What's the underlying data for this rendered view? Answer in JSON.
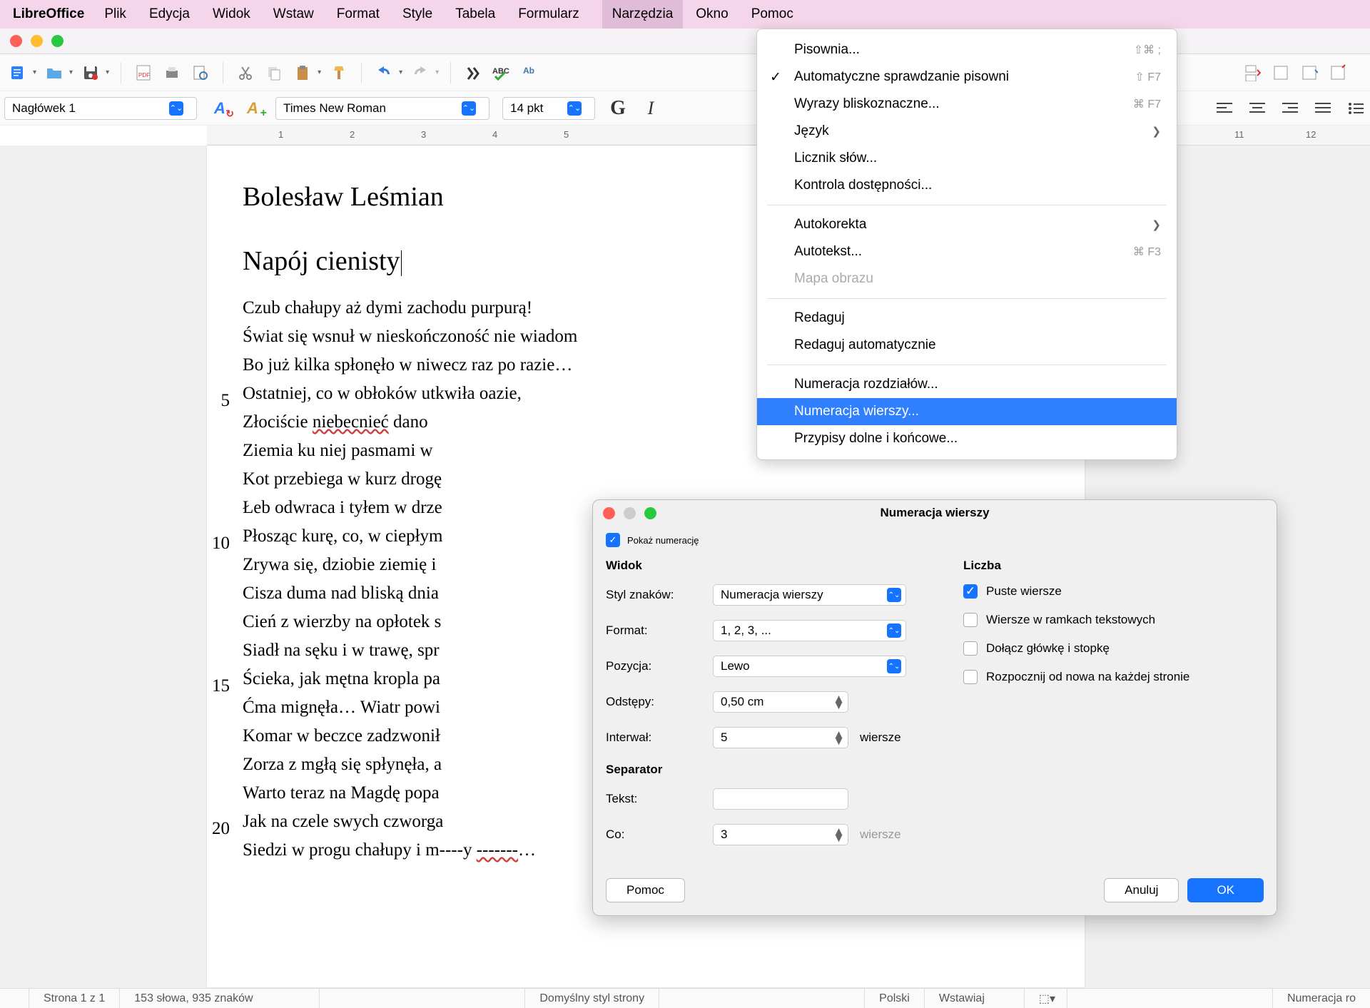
{
  "menubar": {
    "app": "LibreOffice",
    "items": [
      "Plik",
      "Edycja",
      "Widok",
      "Wstaw",
      "Format",
      "Style",
      "Tabela",
      "Formularz",
      "Narzędzia",
      "Okno",
      "Pomoc"
    ],
    "active_index": 8
  },
  "formatbar": {
    "para_style": "Nagłówek 1",
    "font_name": "Times New Roman",
    "font_size": "14 pkt"
  },
  "tools_menu": {
    "items": [
      {
        "label": "Pisownia...",
        "shortcut": "⇧⌘ ;",
        "type": "item"
      },
      {
        "label": "Automatyczne sprawdzanie pisowni",
        "shortcut": "⇧ F7",
        "type": "item",
        "checked": true
      },
      {
        "label": "Wyrazy bliskoznaczne...",
        "shortcut": "⌘ F7",
        "type": "item"
      },
      {
        "label": "Język",
        "type": "submenu"
      },
      {
        "label": "Licznik słów...",
        "type": "item"
      },
      {
        "label": "Kontrola dostępności...",
        "type": "item"
      },
      {
        "type": "sep"
      },
      {
        "label": "Autokorekta",
        "type": "submenu"
      },
      {
        "label": "Autotekst...",
        "shortcut": "⌘ F3",
        "type": "item"
      },
      {
        "label": "Mapa obrazu",
        "type": "item",
        "disabled": true
      },
      {
        "type": "sep"
      },
      {
        "label": "Redaguj",
        "type": "item"
      },
      {
        "label": "Redaguj automatycznie",
        "type": "item"
      },
      {
        "type": "sep"
      },
      {
        "label": "Numeracja rozdziałów...",
        "type": "item"
      },
      {
        "label": "Numeracja wierszy...",
        "type": "item",
        "highlighted": true
      },
      {
        "label": "Przypisy dolne i końcowe...",
        "type": "item"
      }
    ]
  },
  "document": {
    "title": "Bolesław Leśmian",
    "subtitle": "Napój cienisty",
    "lines": [
      "Czub chałupy aż dymi zachodu purpurą!",
      "Świat się wsnuł w nieskończoność nie wiadom",
      "Bo już kilka spłonęło w niwecz raz po razie…",
      "Ostatniej, co w obłoków utkwiła oazie,",
      "Złociście <s>niebecnieć</s> dano",
      "Ziemia ku niej pasmami w ",
      "Kot przebiega w kurz drogę",
      "Łeb odwraca i tyłem w drze",
      "Płosząc kurę, co, w ciepłym",
      "Zrywa się, dziobie ziemię i ",
      "Cisza duma nad bliską dnia",
      "Cień z wierzby na opłotek s",
      "Siadł na sęku i w trawę, spr",
      "Ścieka, jak mętna kropla pa",
      "Ćma mignęła… Wiatr powi",
      "Komar w beczce zadzwonił",
      "Zorza z mgłą się spłynęła, a",
      "Warto teraz na Magdę popa",
      "Jak na czele swych czworga",
      "Siedzi w progu chałupy i m----y <s>-------</s>…"
    ],
    "line_numbers": [
      {
        "n": "5",
        "at": 2
      },
      {
        "n": "10",
        "at": 7
      },
      {
        "n": "15",
        "at": 12
      },
      {
        "n": "20",
        "at": 17
      }
    ]
  },
  "dialog": {
    "title": "Numeracja wierszy",
    "show_numbering": "Pokaż numerację",
    "section_view": "Widok",
    "section_count": "Liczba",
    "labels": {
      "char_style": "Styl znaków:",
      "format": "Format:",
      "position": "Pozycja:",
      "spacing": "Odstępy:",
      "interval": "Interwał:",
      "separator": "Separator",
      "text": "Tekst:",
      "every": "Co:",
      "lines": "wiersze",
      "lines2": "wiersze"
    },
    "values": {
      "char_style": "Numeracja wierszy",
      "format": "1, 2, 3, ...",
      "position": "Lewo",
      "spacing": "0,50 cm",
      "interval": "5",
      "text": "",
      "every": "3"
    },
    "checks": {
      "blank_lines": "Puste wiersze",
      "text_frames": "Wiersze w ramkach tekstowych",
      "header_footer": "Dołącz główkę i stopkę",
      "restart_page": "Rozpocznij od nowa na każdej stronie"
    },
    "buttons": {
      "help": "Pomoc",
      "cancel": "Anuluj",
      "ok": "OK"
    }
  },
  "statusbar": {
    "page": "Strona 1 z 1",
    "words": "153 słowa, 935 znaków",
    "page_style": "Domyślny styl strony",
    "language": "Polski",
    "insert": "Wstawiaj",
    "right": "Numeracja ro"
  },
  "ruler_ticks": [
    "1",
    "2",
    "3",
    "4",
    "5",
    "11",
    "12"
  ]
}
